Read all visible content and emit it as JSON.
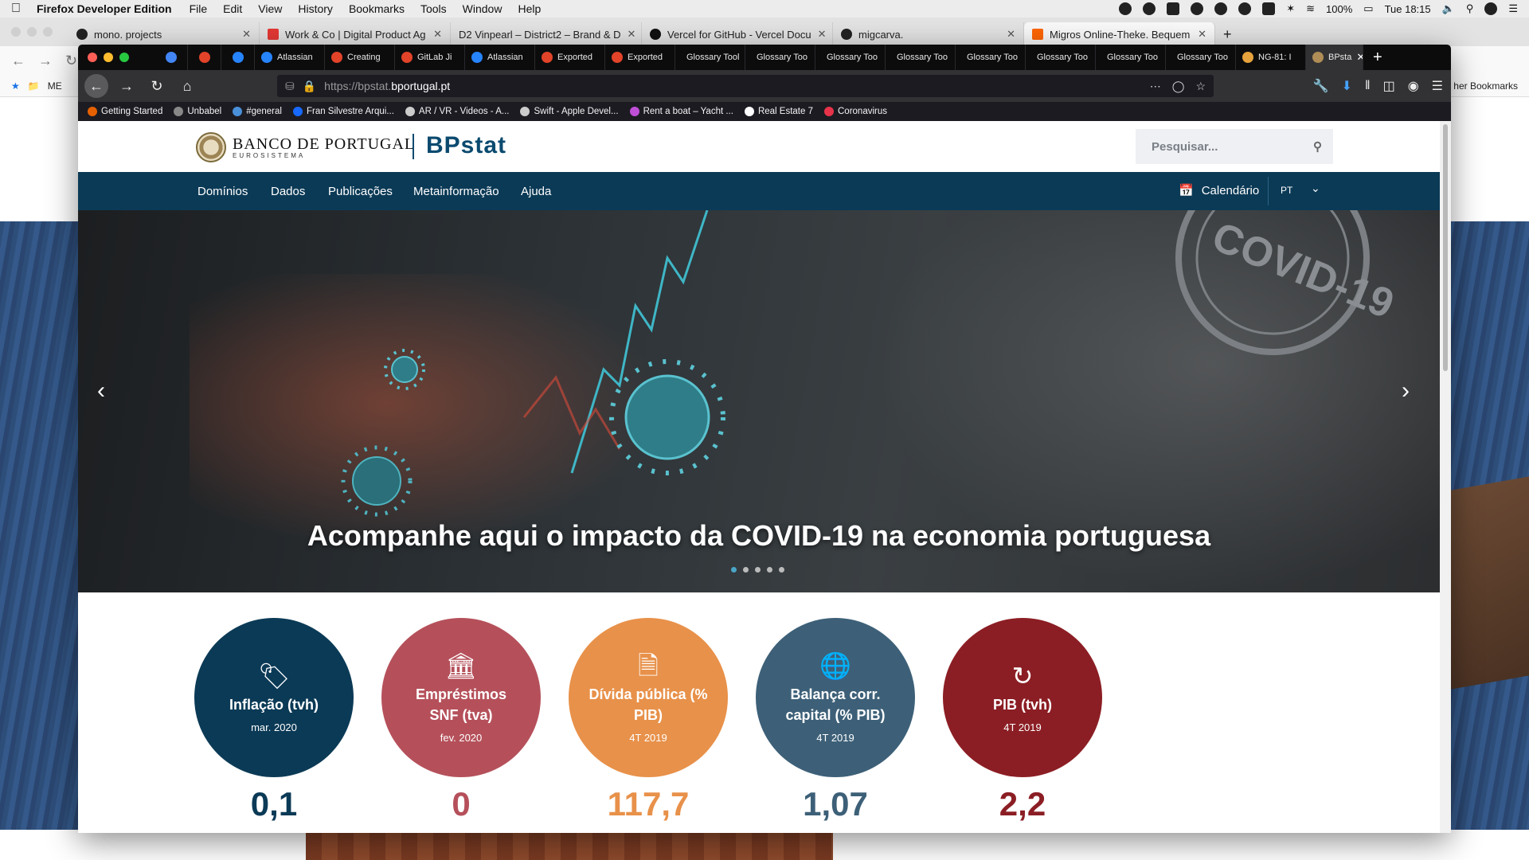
{
  "macbar": {
    "app": "Firefox Developer Edition",
    "menus": [
      "File",
      "Edit",
      "View",
      "History",
      "Bookmarks",
      "Tools",
      "Window",
      "Help"
    ],
    "battery": "100%",
    "clock": "Tue 18:15"
  },
  "bg_window": {
    "tabs": [
      {
        "title": "mono. projects",
        "active": false
      },
      {
        "title": "Work & Co | Digital Product Ag",
        "active": false
      },
      {
        "title": "D2  Vinpearl – District2 – Brand & D",
        "active": false
      },
      {
        "title": "Vercel for GitHub - Vercel Docu",
        "active": false
      },
      {
        "title": "migcarva.",
        "active": false
      },
      {
        "title": "Migros Online-Theke. Bequem",
        "active": true
      }
    ],
    "bookmark_first": "ME",
    "other_bookmarks": "her Bookmarks"
  },
  "tabs": [
    {
      "title": "",
      "type": "pinned",
      "color": "#4285f4"
    },
    {
      "title": "",
      "type": "pinned",
      "color": "#e24329"
    },
    {
      "title": "",
      "type": "pinned",
      "color": "#2684ff"
    },
    {
      "title": "Atlassian",
      "type": "norm",
      "color": "#2684ff"
    },
    {
      "title": "Creating",
      "type": "norm",
      "color": "#e24329"
    },
    {
      "title": "GitLab Ji",
      "type": "norm",
      "color": "#e24329"
    },
    {
      "title": "Atlassian",
      "type": "norm",
      "color": "#2684ff"
    },
    {
      "title": "Exported",
      "type": "norm",
      "color": "#e24329"
    },
    {
      "title": "Exported",
      "type": "norm",
      "color": "#e24329"
    },
    {
      "title": "Glossary Tool",
      "type": "norm",
      "color": ""
    },
    {
      "title": "Glossary Too",
      "type": "norm",
      "color": ""
    },
    {
      "title": "Glossary Too",
      "type": "norm",
      "color": ""
    },
    {
      "title": "Glossary Too",
      "type": "norm",
      "color": ""
    },
    {
      "title": "Glossary Too",
      "type": "norm",
      "color": ""
    },
    {
      "title": "Glossary Too",
      "type": "norm",
      "color": ""
    },
    {
      "title": "Glossary Too",
      "type": "norm",
      "color": ""
    },
    {
      "title": "Glossary Too",
      "type": "norm",
      "color": ""
    },
    {
      "title": "NG-81: I",
      "type": "norm",
      "color": "#e6a23c"
    },
    {
      "title": "BPsta",
      "type": "active",
      "color": "#b08d57"
    }
  ],
  "url": {
    "prefix": "https://bpstat.",
    "host": "bportugal.pt"
  },
  "bookmarks": [
    {
      "label": "Getting Started",
      "color": "#e66000"
    },
    {
      "label": "Unbabel",
      "color": "#888888"
    },
    {
      "label": "#general",
      "color": "#4a90d9"
    },
    {
      "label": "Fran Silvestre Arqui...",
      "color": "#1769ff"
    },
    {
      "label": "AR / VR - Videos - A...",
      "color": "#cccccc"
    },
    {
      "label": "Swift - Apple Devel...",
      "color": "#cccccc"
    },
    {
      "label": "Rent a boat – Yacht ...",
      "color": "#c04fd8"
    },
    {
      "label": "Real Estate 7",
      "color": "#ffffff"
    },
    {
      "label": "Coronavirus",
      "color": "#e8334a"
    }
  ],
  "site": {
    "bank_name": "BANCO DE PORTUGAL",
    "bank_sub": "EUROSISTEMA",
    "product": "BPstat",
    "search_placeholder": "Pesquisar...",
    "nav": [
      "Domínios",
      "Dados",
      "Publicações",
      "Metainformação",
      "Ajuda"
    ],
    "calendar": "Calendário",
    "lang": "PT",
    "hero_title": "Acompanhe aqui o impacto da COVID-19 na economia portuguesa",
    "hero_stamp": "COVID-19",
    "hero_slides": 5,
    "hero_active_slide": 1,
    "stats": [
      {
        "label": "Inflação (tvh)",
        "period": "mar. 2020",
        "value": "0,1",
        "color": "#0b3a56",
        "icon": "price-tag-euro-icon"
      },
      {
        "label": "Empréstimos SNF (tva)",
        "period": "fev. 2020",
        "value": "0",
        "color": "#b5505a",
        "icon": "bank-building-icon"
      },
      {
        "label": "Dívida pública (% PIB)",
        "period": "4T 2019",
        "value": "117,7",
        "color": "#e8914a",
        "icon": "document-euro-icon"
      },
      {
        "label": "Balança corr. capital (% PIB)",
        "period": "4T 2019",
        "value": "1,07",
        "color": "#3d6078",
        "icon": "globe-scale-icon"
      },
      {
        "label": "PIB (tvh)",
        "period": "4T 2019",
        "value": "2,2",
        "color": "#8b1e24",
        "icon": "cycle-euro-icon"
      }
    ]
  }
}
